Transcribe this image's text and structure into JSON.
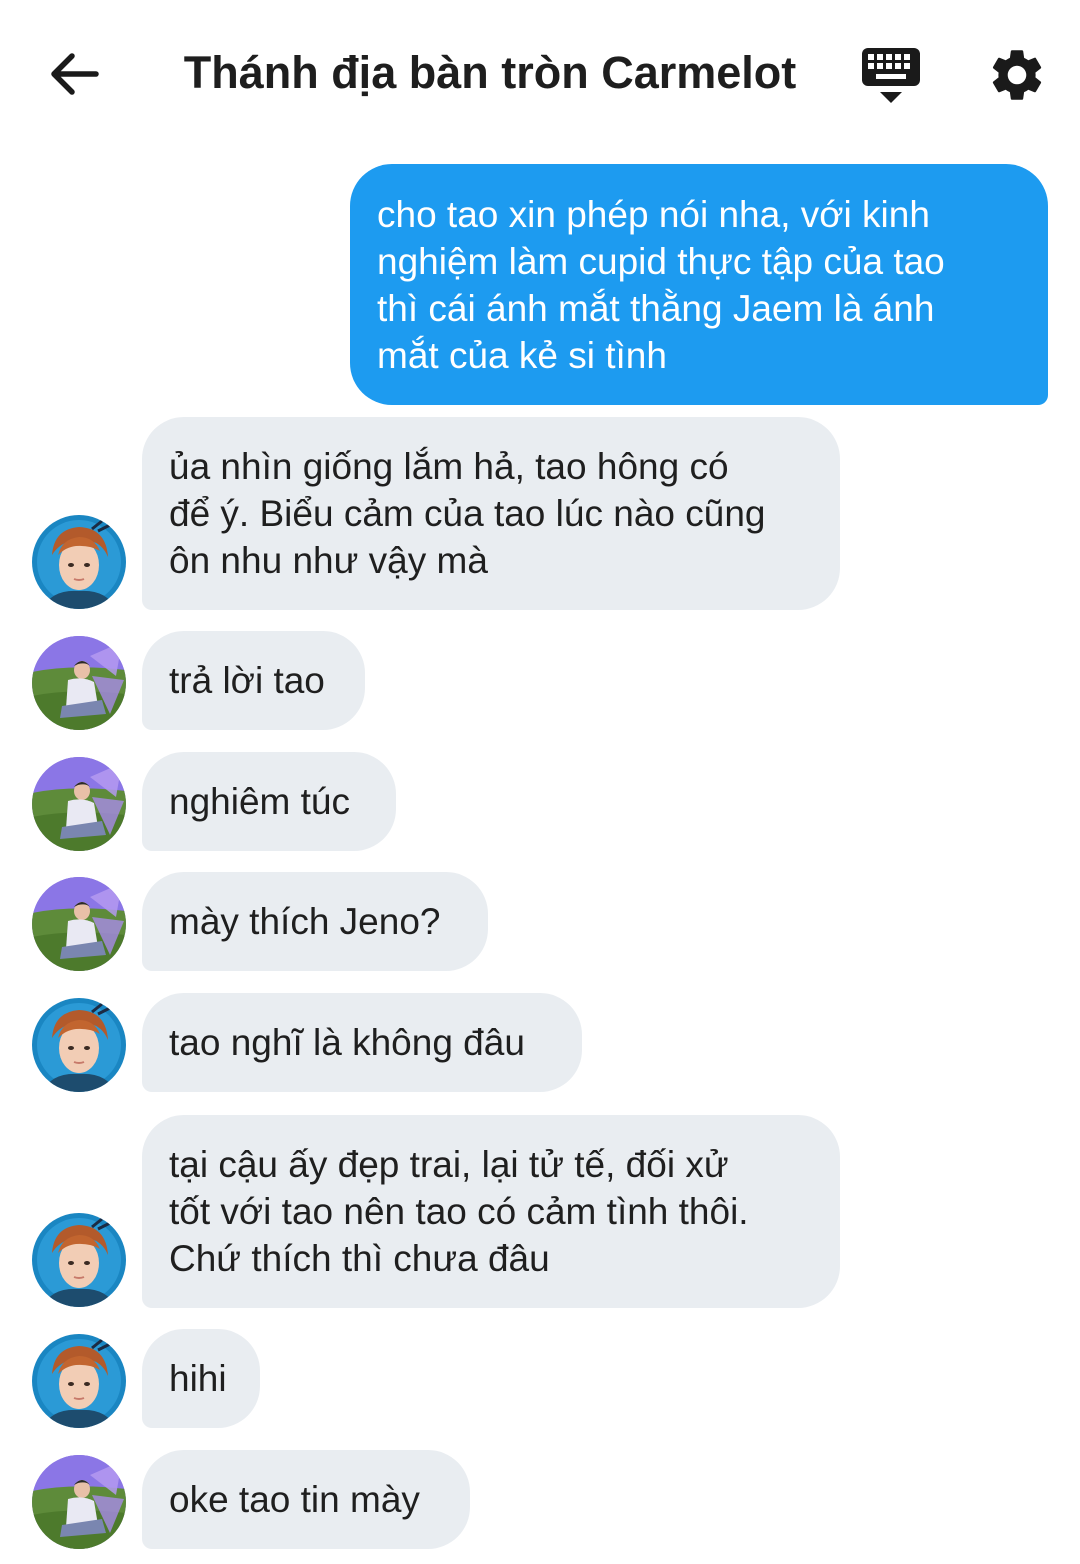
{
  "header": {
    "title": "Thánh địa bàn tròn Carmelot",
    "back_icon": "arrow-left-icon",
    "keyboard_icon": "keyboard-hide-icon",
    "settings_icon": "gear-icon"
  },
  "colors": {
    "outgoing_bubble": "#1d9bf0",
    "incoming_bubble": "#e9edf1"
  },
  "messages": [
    {
      "direction": "out",
      "text": "cho tao xin phép nói nha, với kinh\nnghiệm làm cupid thực tập của tao\nthì cái ánh mắt thằng Jaem là ánh\nmắt của kẻ si tình"
    },
    {
      "direction": "in",
      "avatar": "avatar-a",
      "text": "ủa nhìn giống lắm hả, tao hông có\nđể ý. Biểu cảm của tao lúc nào cũng\nôn nhu như vậy mà"
    },
    {
      "direction": "in",
      "avatar": "avatar-b",
      "text": "trả lời tao"
    },
    {
      "direction": "in",
      "avatar": "avatar-b",
      "text": "nghiêm túc"
    },
    {
      "direction": "in",
      "avatar": "avatar-b",
      "text": "mày thích Jeno?"
    },
    {
      "direction": "in",
      "avatar": "avatar-a",
      "text": "tao nghĩ là không đâu"
    },
    {
      "direction": "in",
      "avatar": "avatar-a",
      "text": "tại cậu ấy đẹp trai, lại tử tế, đối xử\ntốt với tao nên tao có cảm tình thôi.\nChứ thích thì chưa đâu"
    },
    {
      "direction": "in",
      "avatar": "avatar-a",
      "text": "hihi"
    },
    {
      "direction": "in",
      "avatar": "avatar-b",
      "text": "oke tao tin mày"
    }
  ]
}
